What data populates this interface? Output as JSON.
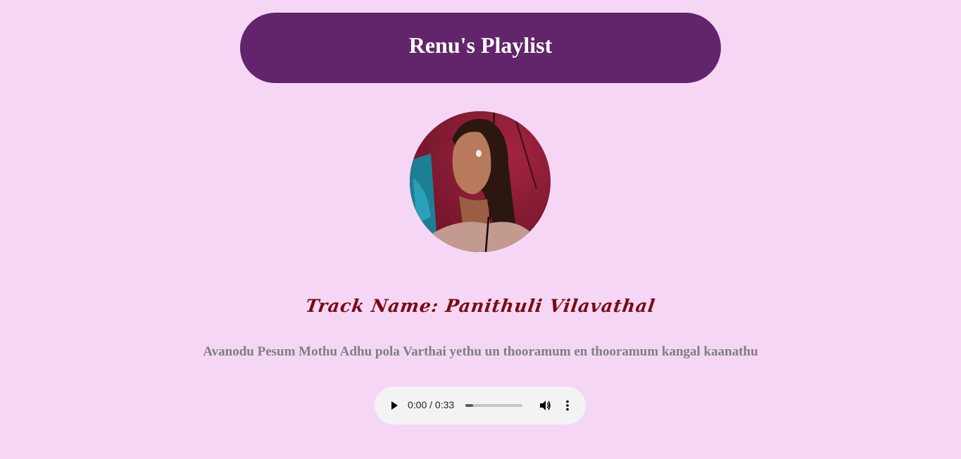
{
  "header": {
    "title": "Renu's Playlist",
    "background": "#62246a"
  },
  "page": {
    "background": "#f6d6f5"
  },
  "track": {
    "name": "Track Name: Panithuli Vilavathal",
    "lyrics": "Avanodu Pesum Mothu Adhu pola Varthai yethu un thooramum en thooramum kangal kaanathu",
    "name_color": "#7a0a12",
    "lyrics_color": "#7f7f7f"
  },
  "player": {
    "time_display": "0:00 / 0:33",
    "progress_fraction": 0.14,
    "play_icon": "play-icon",
    "volume_icon": "volume-icon",
    "menu_icon": "more-vertical-icon"
  }
}
